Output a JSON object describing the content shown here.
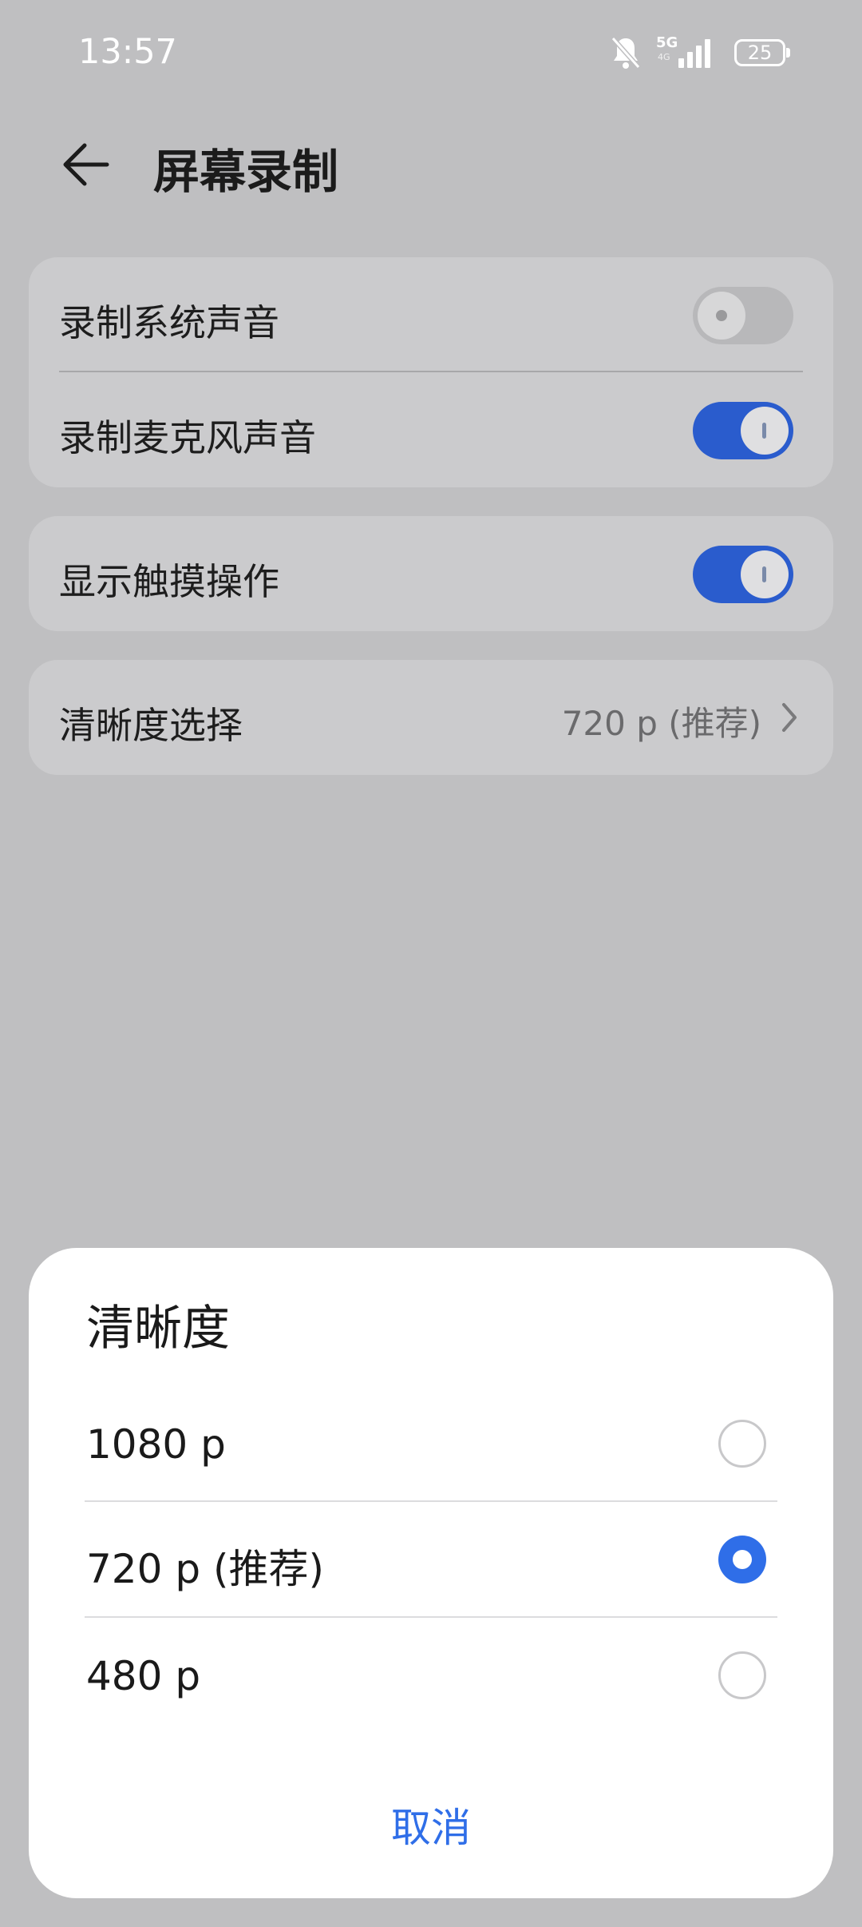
{
  "status_bar": {
    "time": "13:57",
    "network_label": "5G",
    "network_sub_label": "4G",
    "battery_level": "25",
    "icons": [
      "bell-muted-icon",
      "signal-bars-icon",
      "battery-icon"
    ]
  },
  "header": {
    "title": "屏幕录制",
    "back_icon": "arrow-left-icon"
  },
  "settings": {
    "audio_group": [
      {
        "label": "录制系统声音",
        "enabled": false
      },
      {
        "label": "录制麦克风声音",
        "enabled": true
      }
    ],
    "touch": {
      "label": "显示触摸操作",
      "enabled": true
    },
    "resolution": {
      "label": "清晰度选择",
      "value": "720 p (推荐)",
      "icon": "chevron-right-icon"
    }
  },
  "sheet": {
    "title": "清晰度",
    "options": [
      {
        "label": "1080 p",
        "selected": false
      },
      {
        "label": "720 p (推荐)",
        "selected": true
      },
      {
        "label": "480 p",
        "selected": false
      }
    ],
    "cancel_label": "取消"
  },
  "colors": {
    "accent": "#2f6ee8",
    "toggle_on": "#2a5ccd",
    "overlay_background": "#bfbfc1"
  }
}
